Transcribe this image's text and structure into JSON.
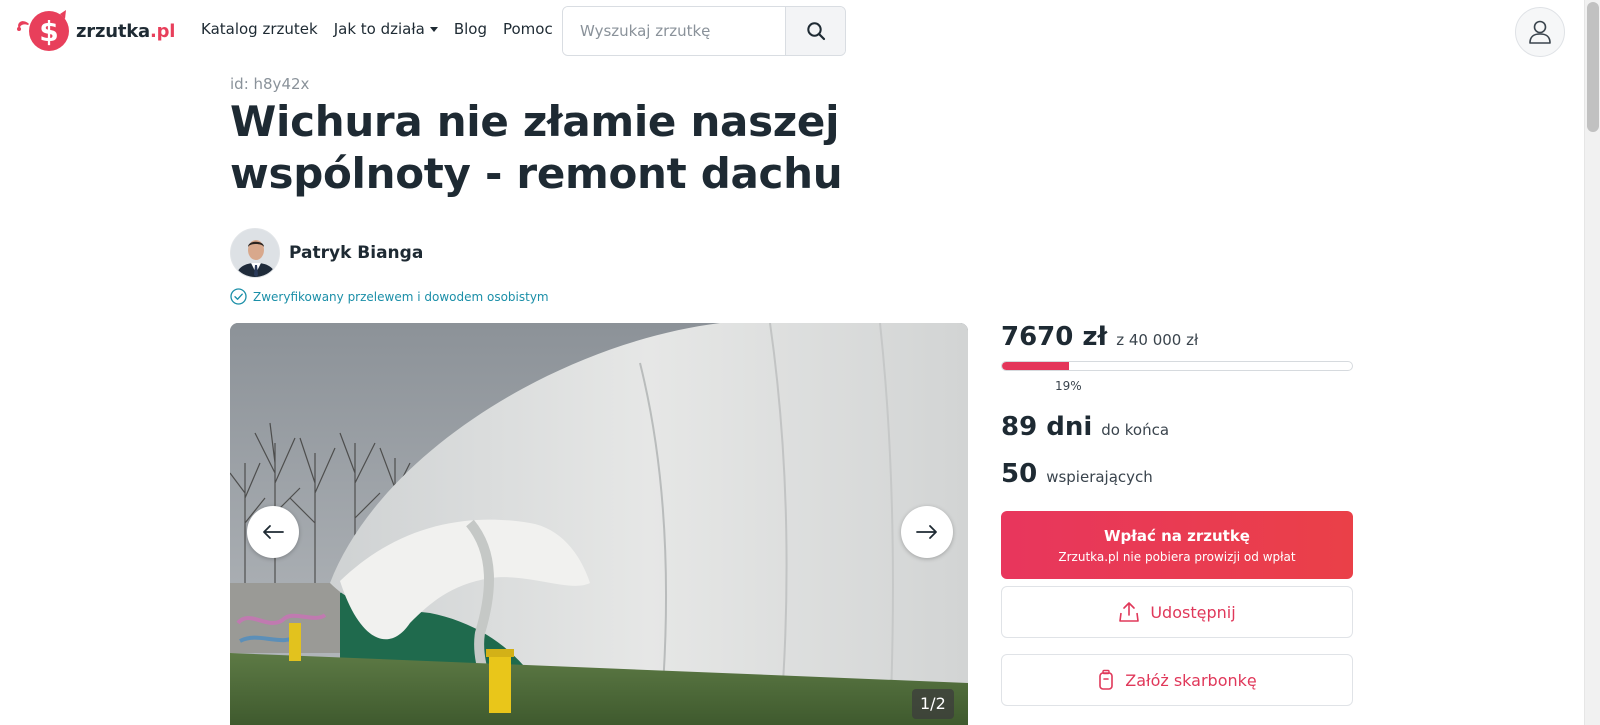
{
  "header": {
    "logo": {
      "name": "zrzutka",
      "accent": ".pl",
      "icon": "piggy-bank-logo-icon"
    },
    "nav": {
      "catalog": "Katalog zrzutek",
      "how_it_works": "Jak to działa",
      "blog": "Blog",
      "help": "Pomoc"
    },
    "search": {
      "placeholder": "Wyszukaj zrzutkę",
      "icon": "search-icon"
    },
    "user_icon": "user-icon"
  },
  "campaign": {
    "id_label": "id: h8y42x",
    "title": "Wichura nie złamie naszej wspólnoty - remont dachu",
    "author": {
      "name": "Patryk Bianga",
      "avatar": "author-avatar"
    },
    "verified": "Zweryfikowany przelewem i dowodem osobistym"
  },
  "gallery": {
    "counter": "1/2",
    "current": 1,
    "total": 2,
    "prev_icon": "arrow-left-icon",
    "next_icon": "arrow-right-icon"
  },
  "funding": {
    "raised": "7670 zł",
    "goal": "z 40 000 zł",
    "progress_fraction": 0.19,
    "progress_label": "19%",
    "days_value": "89 dni",
    "days_label": "do końca",
    "supporters_value": "50",
    "supporters_label": "wspierających"
  },
  "actions": {
    "donate": "Wpłać na zrzutkę",
    "donate_note": "Zrzutka.pl nie pobiera prowizji od wpłat",
    "share": "Udostępnij",
    "share_icon": "share-icon",
    "piggy": "Załóż skarbonkę",
    "piggy_icon": "piggy-box-icon"
  },
  "colors": {
    "brand": "#e83f5b",
    "donate_gradient_start": "#e8365d",
    "donate_gradient_end": "#ea4048",
    "verified": "#1b8fa8",
    "progress": "#e4355a"
  }
}
